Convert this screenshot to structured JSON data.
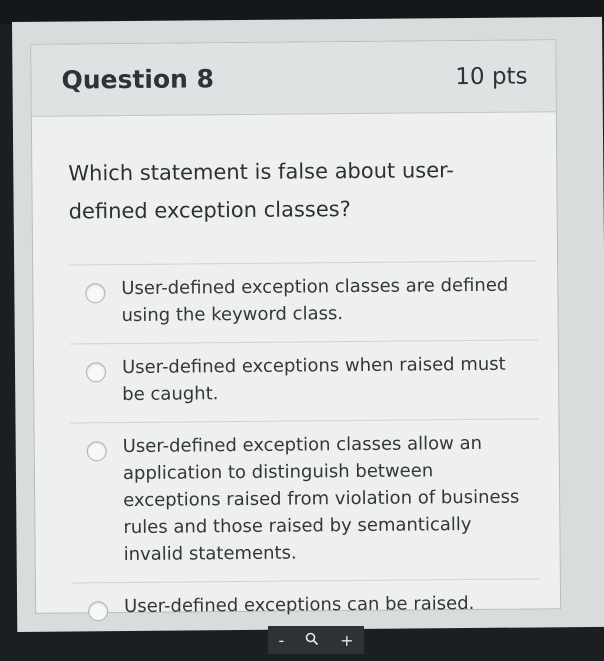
{
  "question": {
    "title": "Question 8",
    "points": "10 pts",
    "text": "Which statement is false about user-defined exception classes?"
  },
  "answers": [
    {
      "label": "User-defined exception classes are defined using the keyword class.",
      "selected": false
    },
    {
      "label": "User-defined exceptions when raised must be caught.",
      "selected": false
    },
    {
      "label": "User-defined exception classes allow an application to distinguish between exceptions raised from violation of business rules and those raised by semantically invalid statements.",
      "selected": false
    },
    {
      "label": "User-defined exceptions can be raised.",
      "selected": false
    }
  ],
  "zoom_controls": {
    "zoom_out": "-",
    "zoom_icon": "magnifier-icon",
    "zoom_in": "+"
  }
}
